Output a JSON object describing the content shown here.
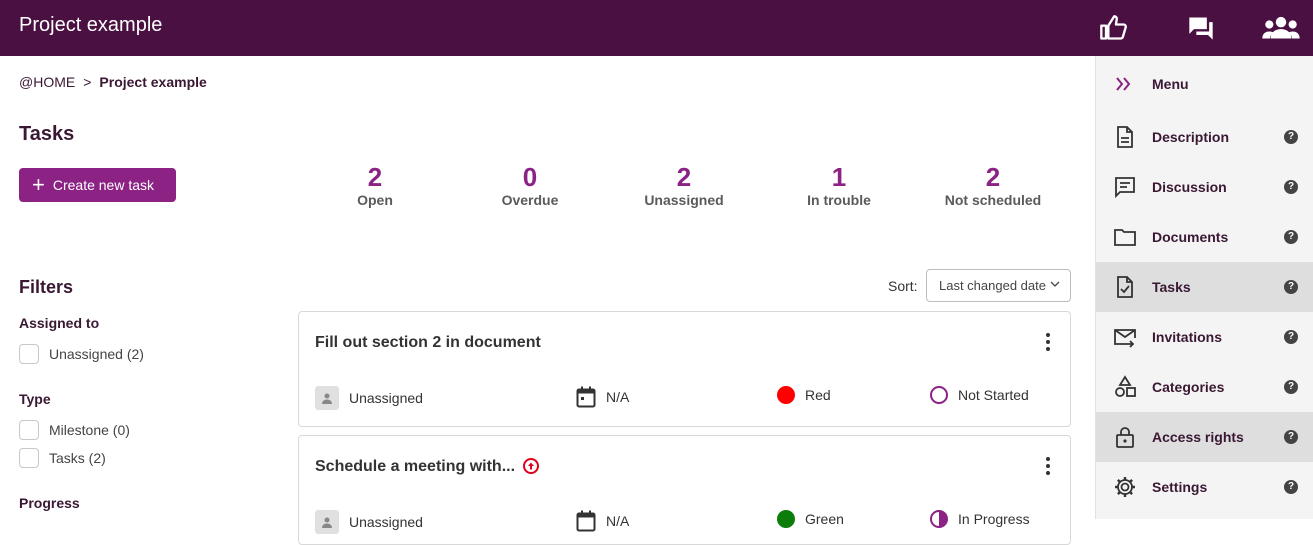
{
  "header": {
    "title": "Project example",
    "icons": [
      "thumbs-up-icon",
      "chat-icon",
      "people-icon"
    ]
  },
  "breadcrumb": {
    "home": "@HOME",
    "separator": ">",
    "current": "Project example"
  },
  "tasks": {
    "heading": "Tasks",
    "create_label": "Create new task",
    "stats": [
      {
        "value": "2",
        "label": "Open"
      },
      {
        "value": "0",
        "label": "Overdue"
      },
      {
        "value": "2",
        "label": "Unassigned"
      },
      {
        "value": "1",
        "label": "In trouble"
      },
      {
        "value": "2",
        "label": "Not scheduled"
      }
    ]
  },
  "filters": {
    "heading": "Filters",
    "assigned_to": {
      "title": "Assigned to",
      "options": [
        "Unassigned (2)"
      ]
    },
    "type": {
      "title": "Type",
      "options": [
        "Milestone (0)",
        "Tasks (2)"
      ]
    },
    "progress": {
      "title": "Progress"
    }
  },
  "sort": {
    "label": "Sort:",
    "value": "Last changed date"
  },
  "task_list": [
    {
      "title": "Fill out section 2 in document",
      "assignee": "Unassigned",
      "due": "N/A",
      "status_color": "Red",
      "status_color_hex": "#ff0000",
      "progress": "Not Started"
    },
    {
      "title": "Schedule a meeting with...",
      "assignee": "Unassigned",
      "due": "N/A",
      "status_color": "Green",
      "status_color_hex": "#0a7d0a",
      "progress": "In Progress"
    }
  ],
  "sidebar": {
    "items": [
      {
        "label": "Menu",
        "icon": "double-chevron-right-icon"
      },
      {
        "label": "Description",
        "icon": "document-icon"
      },
      {
        "label": "Discussion",
        "icon": "comment-icon"
      },
      {
        "label": "Documents",
        "icon": "folder-icon"
      },
      {
        "label": "Tasks",
        "icon": "task-document-icon"
      },
      {
        "label": "Invitations",
        "icon": "mail-arrow-icon"
      },
      {
        "label": "Categories",
        "icon": "shapes-icon"
      },
      {
        "label": "Access rights",
        "icon": "lock-icon"
      },
      {
        "label": "Settings",
        "icon": "gear-icon"
      }
    ],
    "help_glyph": "?"
  },
  "colors": {
    "header_bg": "#4a1042",
    "accent": "#8b2284",
    "sidebar_bg": "#f4f4f4",
    "sidebar_active": "#dedede"
  }
}
